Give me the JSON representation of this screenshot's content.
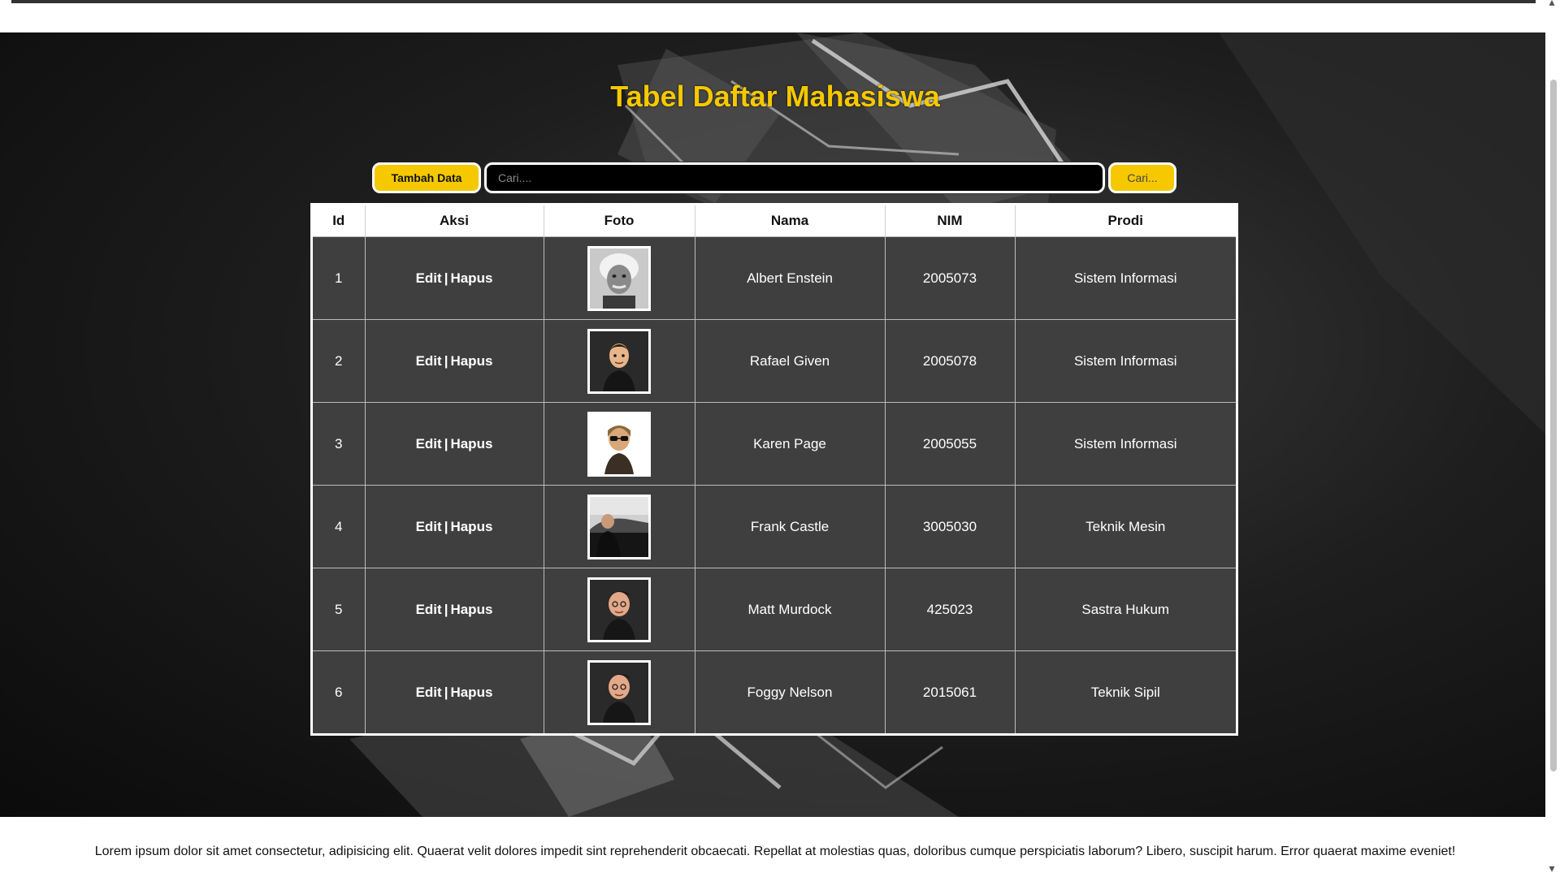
{
  "page": {
    "title": "Tabel Daftar Mahasiswa",
    "footer": "Lorem ipsum dolor sit amet consectetur, adipisicing elit. Quaerat velit dolores impedit sint reprehenderit obcaecati. Repellat at molestias quas, doloribus cumque perspiciatis laborum? Libero, suscipit harum. Error quaerat maxime eveniet!"
  },
  "toolbar": {
    "add_label": "Tambah Data",
    "search_placeholder": "Cari....",
    "search_value": "",
    "search_button_label": "Cari..."
  },
  "table": {
    "headers": [
      "Id",
      "Aksi",
      "Foto",
      "Nama",
      "NIM",
      "Prodi"
    ],
    "edit_label": "Edit",
    "separator": "|",
    "delete_label": "Hapus",
    "rows": [
      {
        "id": "1",
        "photo_icon": "portrait-photo-icon",
        "nama": "Albert Enstein",
        "nim": "2005073",
        "prodi": "Sistem Informasi"
      },
      {
        "id": "2",
        "photo_icon": "cartoon-avatar-icon",
        "nama": "Rafael Given",
        "nim": "2005078",
        "prodi": "Sistem Informasi"
      },
      {
        "id": "3",
        "photo_icon": "cartoon-avatar-glasses-icon",
        "nama": "Karen Page",
        "nim": "2005055",
        "prodi": "Sistem Informasi"
      },
      {
        "id": "4",
        "photo_icon": "car-photo-icon",
        "nama": "Frank Castle",
        "nim": "3005030",
        "prodi": "Teknik Mesin"
      },
      {
        "id": "5",
        "photo_icon": "cartoon-avatar-icon",
        "nama": "Matt Murdock",
        "nim": "425023",
        "prodi": "Sastra Hukum"
      },
      {
        "id": "6",
        "photo_icon": "cartoon-avatar-icon",
        "nama": "Foggy Nelson",
        "nim": "2015061",
        "prodi": "Teknik Sipil"
      }
    ]
  },
  "colors": {
    "accent": "#f5c800",
    "table_body": "#3f3f3f",
    "table_header": "#ffffff"
  }
}
